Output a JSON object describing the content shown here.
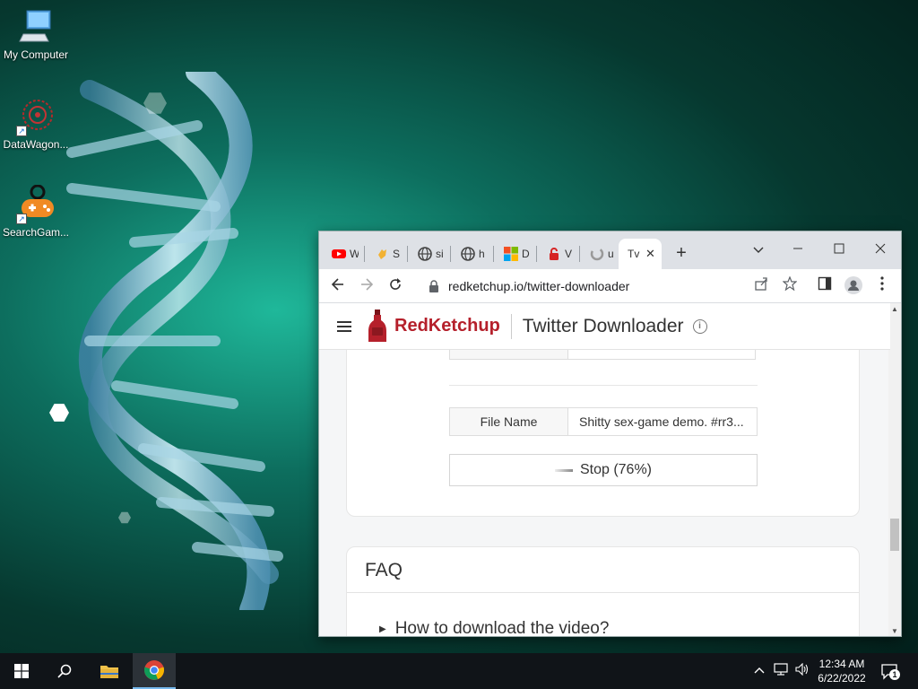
{
  "desktop": {
    "icons": [
      {
        "label": "My Computer"
      },
      {
        "label": "DataWagon..."
      },
      {
        "label": "SearchGam..."
      }
    ]
  },
  "browser": {
    "tabs": [
      {
        "label": "W",
        "icon": "youtube-icon"
      },
      {
        "label": "S",
        "icon": "hand-icon"
      },
      {
        "label": "si",
        "icon": "globe-icon"
      },
      {
        "label": "h",
        "icon": "globe-icon"
      },
      {
        "label": "D",
        "icon": "windows-logo-icon"
      },
      {
        "label": "V",
        "icon": "lock-red-icon"
      },
      {
        "label": "u",
        "icon": "loading-icon"
      },
      {
        "label": "Tv",
        "icon": "",
        "active": true
      }
    ],
    "url": "redketchup.io/twitter-downloader"
  },
  "page": {
    "brand": "RedKetchup",
    "title": "Twitter Downloader",
    "info_symbol": "i",
    "file_name_label": "File Name",
    "file_name_value": "Shitty sex-game demo. #rr3...",
    "stop_button": "Stop (76%)",
    "progress_percent": 76,
    "faq_title": "FAQ",
    "faq_question": "How to download the video?"
  },
  "taskbar": {
    "time": "12:34 AM",
    "date": "6/22/2022",
    "notification_count": "1"
  },
  "colors": {
    "brand_red": "#b5202b",
    "taskbar": "#101418",
    "tabstrip": "#dee1e6"
  }
}
